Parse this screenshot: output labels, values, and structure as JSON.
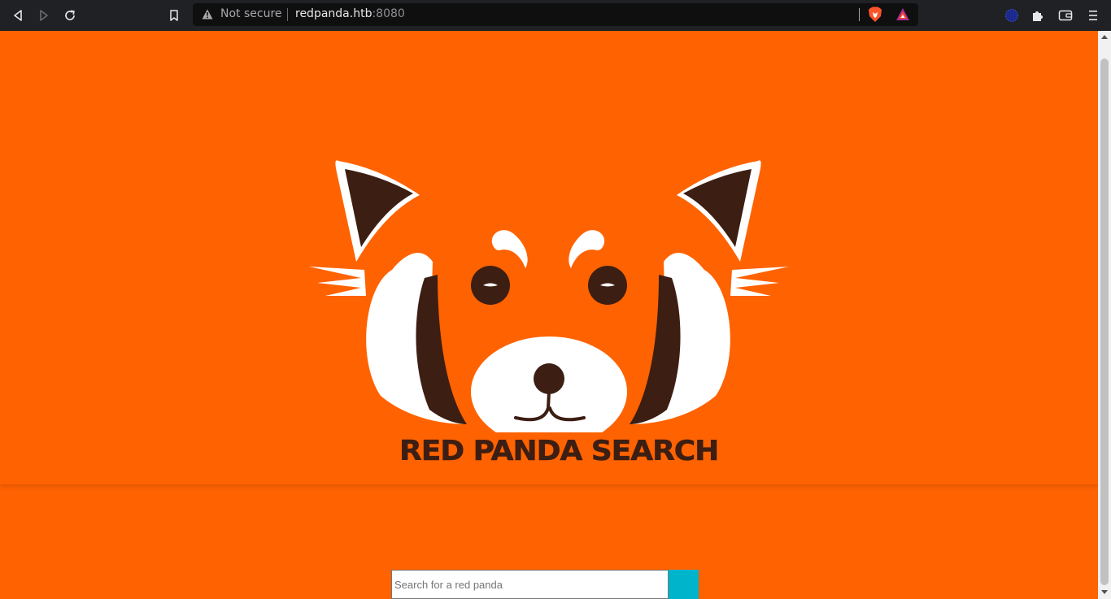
{
  "browser": {
    "security_label": "Not secure",
    "url_host": "redpanda.htb",
    "url_port": ":8080",
    "icons": [
      "back-icon",
      "forward-icon",
      "reload-icon",
      "bookmark-icon",
      "warning-icon",
      "brave-shields-icon",
      "brave-rewards-icon",
      "vpn-icon",
      "extensions-icon",
      "wallet-icon",
      "menu-icon"
    ]
  },
  "page": {
    "title_parts": [
      "RED",
      "PANDA",
      "SEARCH"
    ],
    "search": {
      "placeholder": "Search for a red panda",
      "value": ""
    }
  },
  "colors": {
    "background": "#ff6200",
    "panda_dark": "#3d1e13",
    "search_button": "#00b4cc"
  }
}
